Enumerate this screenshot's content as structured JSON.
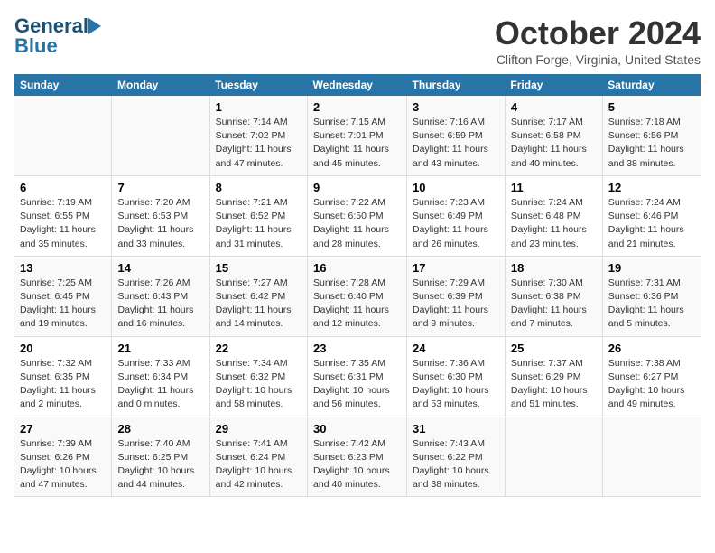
{
  "logo": {
    "line1": "General",
    "line2": "Blue",
    "arrow": "▶"
  },
  "title": "October 2024",
  "subtitle": "Clifton Forge, Virginia, United States",
  "days_of_week": [
    "Sunday",
    "Monday",
    "Tuesday",
    "Wednesday",
    "Thursday",
    "Friday",
    "Saturday"
  ],
  "weeks": [
    [
      {
        "day": "",
        "info": ""
      },
      {
        "day": "",
        "info": ""
      },
      {
        "day": "1",
        "info": "Sunrise: 7:14 AM\nSunset: 7:02 PM\nDaylight: 11 hours\nand 47 minutes."
      },
      {
        "day": "2",
        "info": "Sunrise: 7:15 AM\nSunset: 7:01 PM\nDaylight: 11 hours\nand 45 minutes."
      },
      {
        "day": "3",
        "info": "Sunrise: 7:16 AM\nSunset: 6:59 PM\nDaylight: 11 hours\nand 43 minutes."
      },
      {
        "day": "4",
        "info": "Sunrise: 7:17 AM\nSunset: 6:58 PM\nDaylight: 11 hours\nand 40 minutes."
      },
      {
        "day": "5",
        "info": "Sunrise: 7:18 AM\nSunset: 6:56 PM\nDaylight: 11 hours\nand 38 minutes."
      }
    ],
    [
      {
        "day": "6",
        "info": "Sunrise: 7:19 AM\nSunset: 6:55 PM\nDaylight: 11 hours\nand 35 minutes."
      },
      {
        "day": "7",
        "info": "Sunrise: 7:20 AM\nSunset: 6:53 PM\nDaylight: 11 hours\nand 33 minutes."
      },
      {
        "day": "8",
        "info": "Sunrise: 7:21 AM\nSunset: 6:52 PM\nDaylight: 11 hours\nand 31 minutes."
      },
      {
        "day": "9",
        "info": "Sunrise: 7:22 AM\nSunset: 6:50 PM\nDaylight: 11 hours\nand 28 minutes."
      },
      {
        "day": "10",
        "info": "Sunrise: 7:23 AM\nSunset: 6:49 PM\nDaylight: 11 hours\nand 26 minutes."
      },
      {
        "day": "11",
        "info": "Sunrise: 7:24 AM\nSunset: 6:48 PM\nDaylight: 11 hours\nand 23 minutes."
      },
      {
        "day": "12",
        "info": "Sunrise: 7:24 AM\nSunset: 6:46 PM\nDaylight: 11 hours\nand 21 minutes."
      }
    ],
    [
      {
        "day": "13",
        "info": "Sunrise: 7:25 AM\nSunset: 6:45 PM\nDaylight: 11 hours\nand 19 minutes."
      },
      {
        "day": "14",
        "info": "Sunrise: 7:26 AM\nSunset: 6:43 PM\nDaylight: 11 hours\nand 16 minutes."
      },
      {
        "day": "15",
        "info": "Sunrise: 7:27 AM\nSunset: 6:42 PM\nDaylight: 11 hours\nand 14 minutes."
      },
      {
        "day": "16",
        "info": "Sunrise: 7:28 AM\nSunset: 6:40 PM\nDaylight: 11 hours\nand 12 minutes."
      },
      {
        "day": "17",
        "info": "Sunrise: 7:29 AM\nSunset: 6:39 PM\nDaylight: 11 hours\nand 9 minutes."
      },
      {
        "day": "18",
        "info": "Sunrise: 7:30 AM\nSunset: 6:38 PM\nDaylight: 11 hours\nand 7 minutes."
      },
      {
        "day": "19",
        "info": "Sunrise: 7:31 AM\nSunset: 6:36 PM\nDaylight: 11 hours\nand 5 minutes."
      }
    ],
    [
      {
        "day": "20",
        "info": "Sunrise: 7:32 AM\nSunset: 6:35 PM\nDaylight: 11 hours\nand 2 minutes."
      },
      {
        "day": "21",
        "info": "Sunrise: 7:33 AM\nSunset: 6:34 PM\nDaylight: 11 hours\nand 0 minutes."
      },
      {
        "day": "22",
        "info": "Sunrise: 7:34 AM\nSunset: 6:32 PM\nDaylight: 10 hours\nand 58 minutes."
      },
      {
        "day": "23",
        "info": "Sunrise: 7:35 AM\nSunset: 6:31 PM\nDaylight: 10 hours\nand 56 minutes."
      },
      {
        "day": "24",
        "info": "Sunrise: 7:36 AM\nSunset: 6:30 PM\nDaylight: 10 hours\nand 53 minutes."
      },
      {
        "day": "25",
        "info": "Sunrise: 7:37 AM\nSunset: 6:29 PM\nDaylight: 10 hours\nand 51 minutes."
      },
      {
        "day": "26",
        "info": "Sunrise: 7:38 AM\nSunset: 6:27 PM\nDaylight: 10 hours\nand 49 minutes."
      }
    ],
    [
      {
        "day": "27",
        "info": "Sunrise: 7:39 AM\nSunset: 6:26 PM\nDaylight: 10 hours\nand 47 minutes."
      },
      {
        "day": "28",
        "info": "Sunrise: 7:40 AM\nSunset: 6:25 PM\nDaylight: 10 hours\nand 44 minutes."
      },
      {
        "day": "29",
        "info": "Sunrise: 7:41 AM\nSunset: 6:24 PM\nDaylight: 10 hours\nand 42 minutes."
      },
      {
        "day": "30",
        "info": "Sunrise: 7:42 AM\nSunset: 6:23 PM\nDaylight: 10 hours\nand 40 minutes."
      },
      {
        "day": "31",
        "info": "Sunrise: 7:43 AM\nSunset: 6:22 PM\nDaylight: 10 hours\nand 38 minutes."
      },
      {
        "day": "",
        "info": ""
      },
      {
        "day": "",
        "info": ""
      }
    ]
  ]
}
